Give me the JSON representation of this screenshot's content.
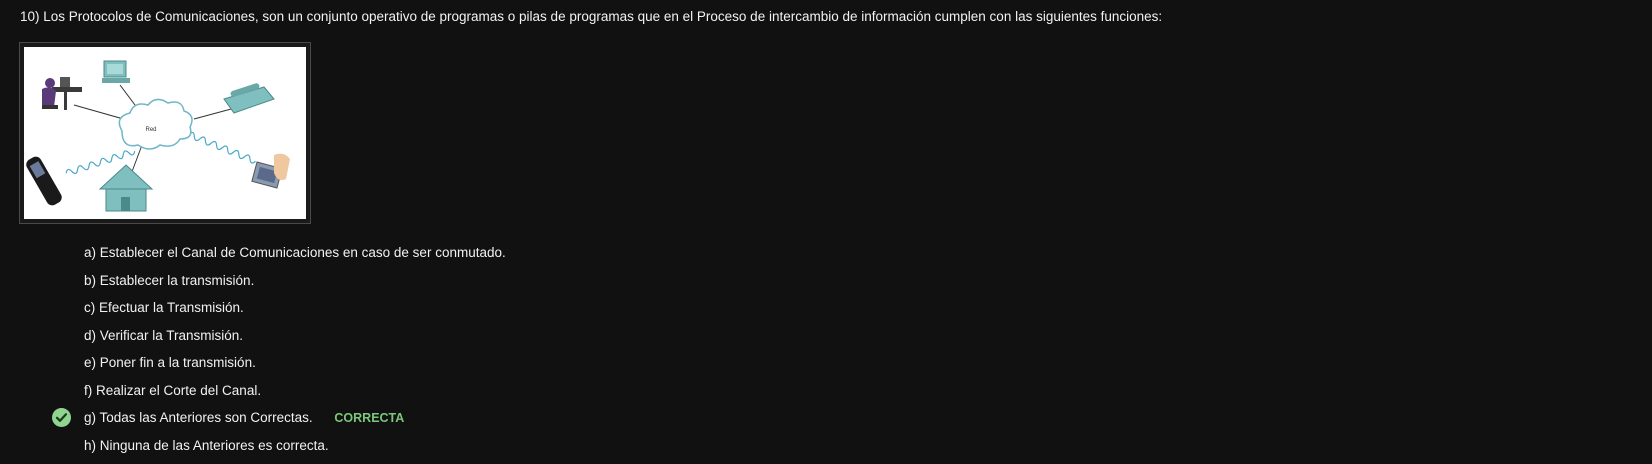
{
  "question": {
    "text": "10) Los Protocolos de Comunicaciones, son un conjunto operativo de programas o pilas de programas que en el Proceso de intercambio de información cumplen con las siguientes funciones:"
  },
  "figure": {
    "cloud_label": "Red",
    "devices": [
      "person-at-desk-icon",
      "desktop-computer-icon",
      "telephone-icon",
      "cell-phone-icon",
      "house-icon",
      "tablet-icon"
    ]
  },
  "options": [
    {
      "label": "a) Establecer el Canal de Comunicaciones en caso de ser conmutado."
    },
    {
      "label": "b) Establecer la transmisión."
    },
    {
      "label": "c) Efectuar la Transmisión."
    },
    {
      "label": "d) Verificar la Transmisión."
    },
    {
      "label": "e) Poner fin a la transmisión."
    },
    {
      "label": "f) Realizar el Corte del Canal."
    },
    {
      "label": "g) Todas las Anteriores son Correctas.",
      "badge": "CORRECTA",
      "selected": true
    },
    {
      "label": "h) Ninguna de las Anteriores es correcta."
    }
  ],
  "colors": {
    "background": "#111111",
    "text": "#f2f2f2",
    "correct": "#7dc77a",
    "check_circle": "#8fd58f"
  }
}
